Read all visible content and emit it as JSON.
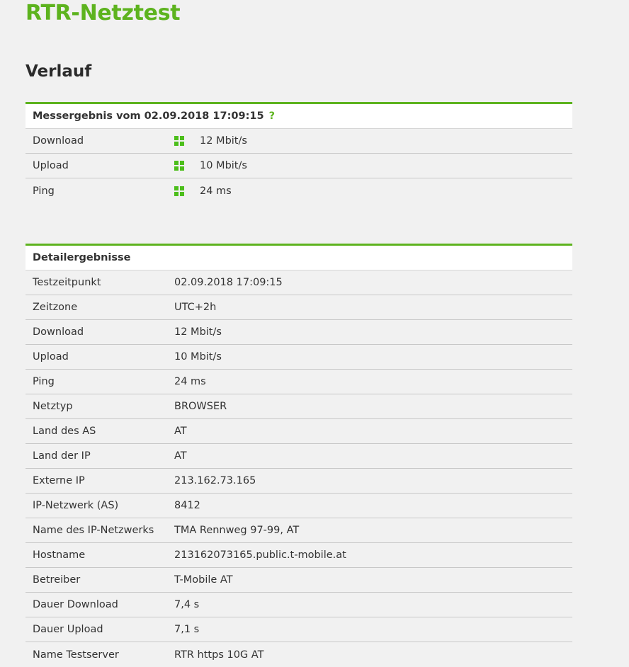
{
  "site": {
    "title": "RTR-Netztest"
  },
  "page": {
    "heading": "Verlauf"
  },
  "summary": {
    "title": "Messergebnis vom 02.09.2018 17:09:15",
    "help_label": "?",
    "classification_color": "#4cbe1b",
    "rows": [
      {
        "label": "Download",
        "value": "12 Mbit/s",
        "icon": "classification-green-icon"
      },
      {
        "label": "Upload",
        "value": "10 Mbit/s",
        "icon": "classification-green-icon"
      },
      {
        "label": "Ping",
        "value": "24 ms",
        "icon": "classification-green-icon"
      }
    ]
  },
  "details": {
    "title": "Detailergebnisse",
    "rows": [
      {
        "label": "Testzeitpunkt",
        "value": "02.09.2018 17:09:15"
      },
      {
        "label": "Zeitzone",
        "value": "UTC+2h"
      },
      {
        "label": "Download",
        "value": "12 Mbit/s"
      },
      {
        "label": "Upload",
        "value": "10 Mbit/s"
      },
      {
        "label": "Ping",
        "value": "24 ms"
      },
      {
        "label": "Netztyp",
        "value": "BROWSER"
      },
      {
        "label": "Land des AS",
        "value": "AT"
      },
      {
        "label": "Land der IP",
        "value": "AT"
      },
      {
        "label": "Externe IP",
        "value": "213.162.73.165"
      },
      {
        "label": "IP-Netzwerk (AS)",
        "value": "8412"
      },
      {
        "label": "Name des IP-Netzwerks",
        "value": "TMA Rennweg 97-99, AT"
      },
      {
        "label": "Hostname",
        "value": "213162073165.public.t-mobile.at"
      },
      {
        "label": "Betreiber",
        "value": "T-Mobile AT"
      },
      {
        "label": "Dauer Download",
        "value": "7,4 s"
      },
      {
        "label": "Dauer Upload",
        "value": "7,1 s"
      },
      {
        "label": "Name Testserver",
        "value": "RTR https 10G AT"
      }
    ]
  }
}
